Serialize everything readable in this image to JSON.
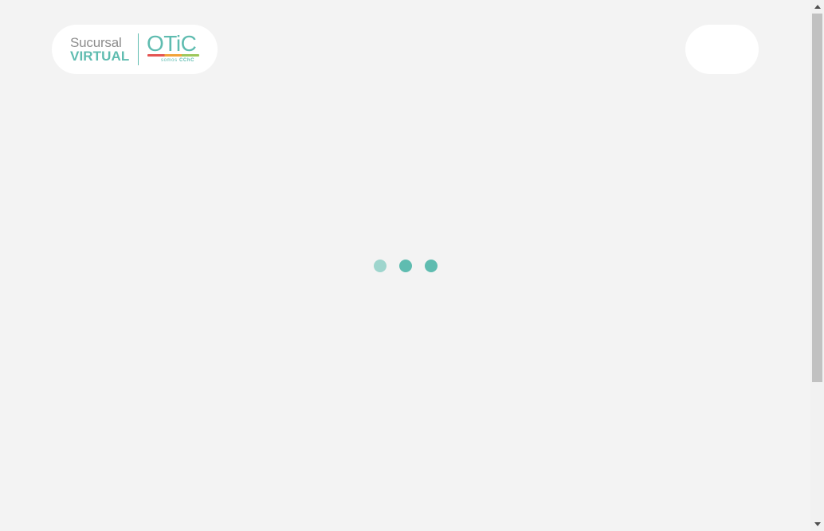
{
  "header": {
    "logo": {
      "line1": "Sucursal",
      "line2": "VIRTUAL",
      "brand_word": "OTiC",
      "brand_sub_prefix": "somos",
      "brand_sub_name": "CChC"
    }
  },
  "colors": {
    "background": "#f3f3f3",
    "accent": "#5fbcb0",
    "accent_light": "#9ed5cd",
    "logo_gray": "#8d8d8d",
    "pill_bg": "#ffffff"
  },
  "icons": {
    "loader": "loading-dots-icon",
    "scroll_up": "scroll-up-arrow-icon",
    "scroll_down": "scroll-down-arrow-icon"
  }
}
